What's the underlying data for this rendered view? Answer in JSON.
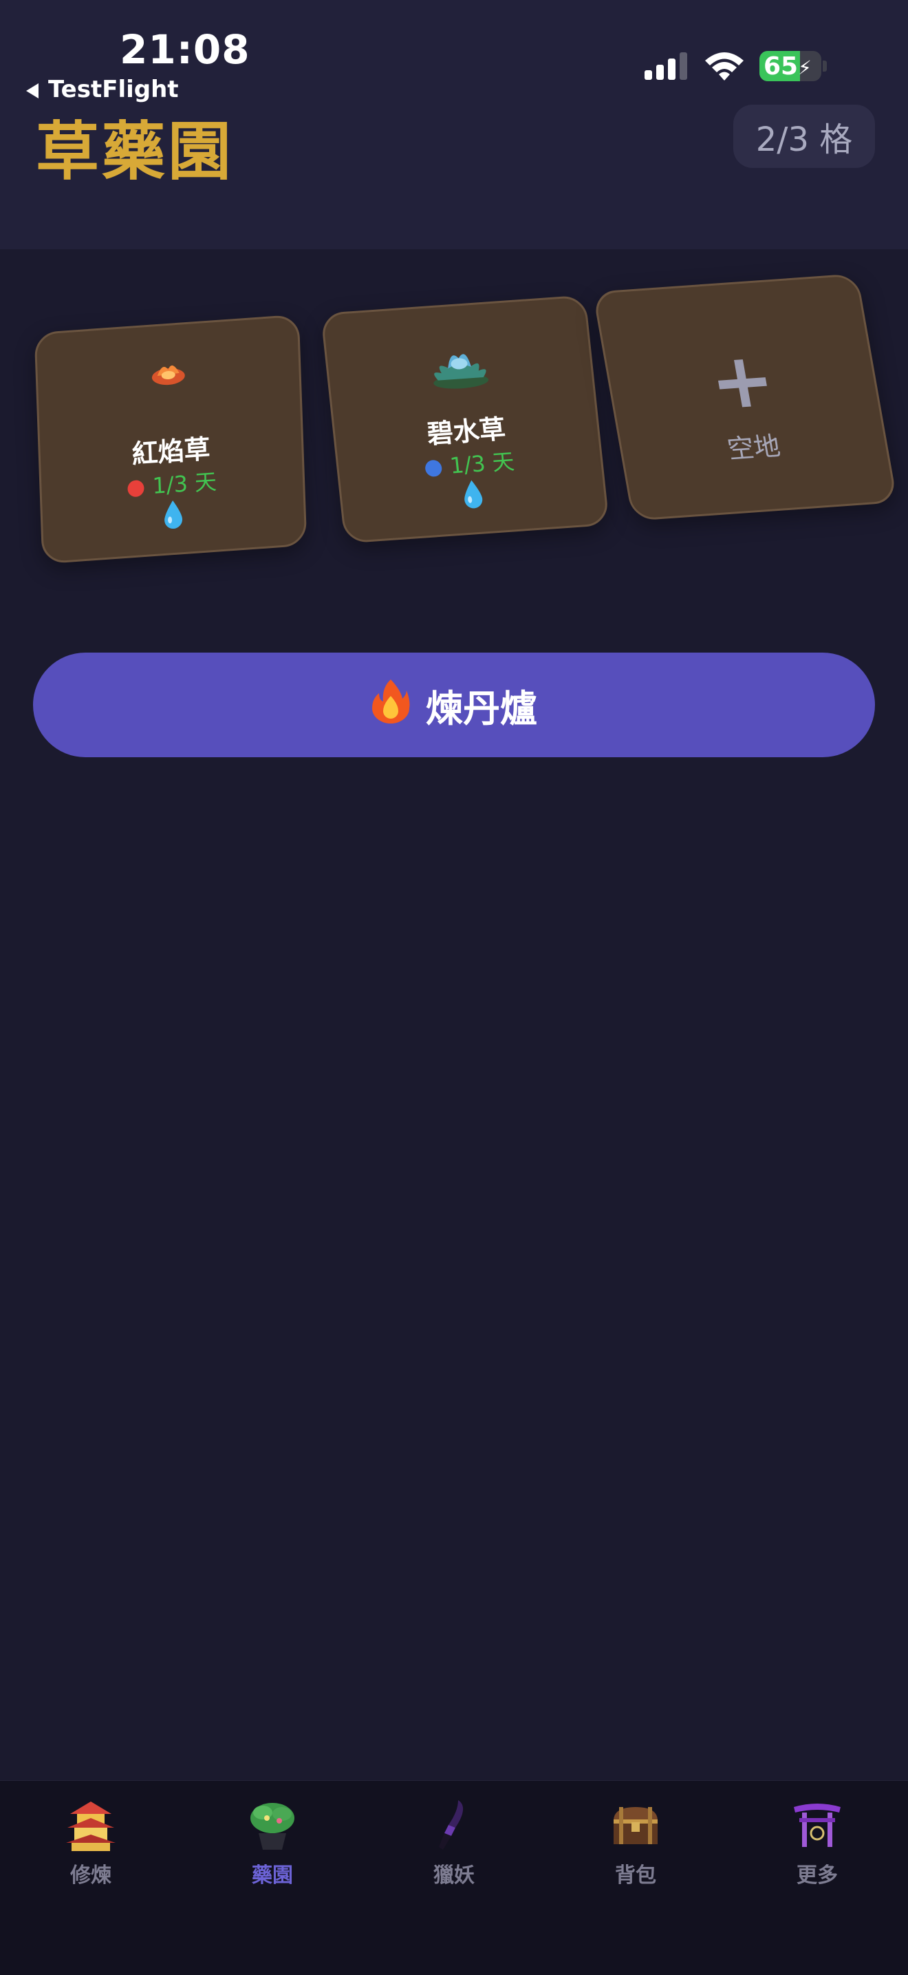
{
  "status_bar": {
    "time": "21:08",
    "battery": "65",
    "battery_level": 0.65,
    "back_label": "TestFlight"
  },
  "header": {
    "title": "草藥園",
    "slot_count": "2/3 格"
  },
  "plots": [
    {
      "name": "紅焰草",
      "growth": "1/3 天",
      "dot_color": "#e8403a",
      "icon": "red-flame-herb-icon"
    },
    {
      "name": "碧水草",
      "growth": "1/3 天",
      "dot_color": "#3f77e0",
      "icon": "blue-water-herb-icon"
    },
    {
      "empty_label": "空地",
      "plus": "+"
    }
  ],
  "alchemy_button": {
    "label": "煉丹爐",
    "icon": "fire-icon"
  },
  "tabs": [
    {
      "label": "修煉",
      "icon": "pagoda-icon",
      "active": false
    },
    {
      "label": "藥園",
      "icon": "herb-pot-icon",
      "active": true
    },
    {
      "label": "獵妖",
      "icon": "dark-blade-icon",
      "active": false
    },
    {
      "label": "背包",
      "icon": "treasure-chest-icon",
      "active": false
    },
    {
      "label": "更多",
      "icon": "torii-more-icon",
      "active": false
    }
  ]
}
